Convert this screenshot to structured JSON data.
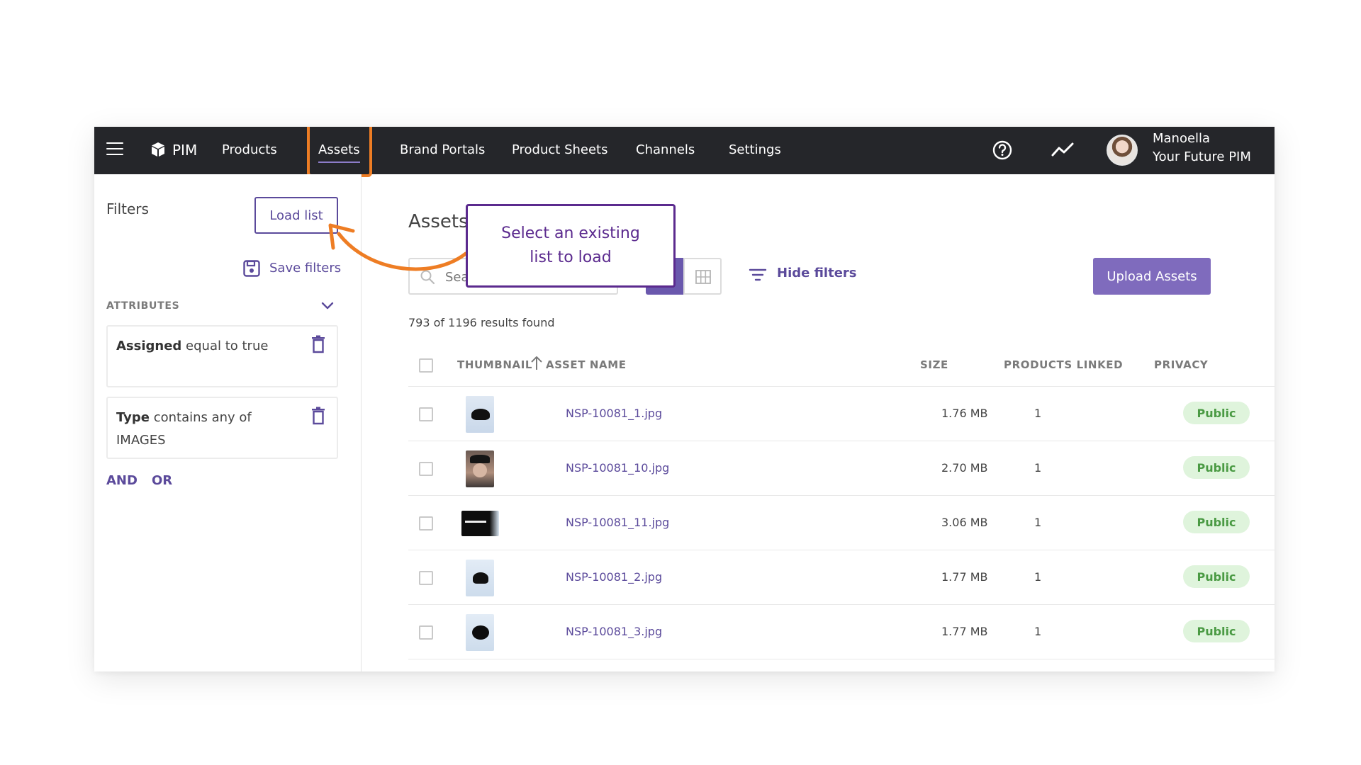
{
  "topbar": {
    "brand": "PIM",
    "nav": [
      "Products",
      "Assets",
      "Brand Portals",
      "Product Sheets",
      "Channels",
      "Settings"
    ],
    "active": "Assets",
    "user_name": "Manoella",
    "user_org": "Your Future PIM"
  },
  "sidebar": {
    "title": "Filters",
    "load_list_label": "Load list",
    "save_filters_label": "Save filters",
    "section_label": "ATTRIBUTES",
    "filters": [
      {
        "field": "Assigned",
        "rest": " equal to true"
      },
      {
        "field": "Type",
        "rest": " contains any of IMAGES"
      }
    ],
    "logic_and": "AND",
    "logic_or": "OR"
  },
  "main": {
    "title": "Assets",
    "search_placeholder": "Search",
    "hide_filters_label": "Hide filters",
    "upload_label": "Upload Assets",
    "results_text": "793 of 1196 results found",
    "columns": [
      "THUMBNAIL",
      "ASSET NAME",
      "SIZE",
      "PRODUCTS LINKED",
      "PRIVACY"
    ],
    "rows": [
      {
        "name": "NSP-10081_1.jpg",
        "size": "1.76 MB",
        "linked": "1",
        "privacy": "Public"
      },
      {
        "name": "NSP-10081_10.jpg",
        "size": "2.70 MB",
        "linked": "1",
        "privacy": "Public"
      },
      {
        "name": "NSP-10081_11.jpg",
        "size": "3.06 MB",
        "linked": "1",
        "privacy": "Public"
      },
      {
        "name": "NSP-10081_2.jpg",
        "size": "1.77 MB",
        "linked": "1",
        "privacy": "Public"
      },
      {
        "name": "NSP-10081_3.jpg",
        "size": "1.77 MB",
        "linked": "1",
        "privacy": "Public"
      }
    ]
  },
  "callout": {
    "text": "Select an existing list to load"
  },
  "colors": {
    "topbar": "#25262a",
    "accent": "#5b4a9b",
    "highlight": "#ee7d24",
    "public_badge_bg": "#dff4dc",
    "public_badge_fg": "#4a9a43"
  }
}
